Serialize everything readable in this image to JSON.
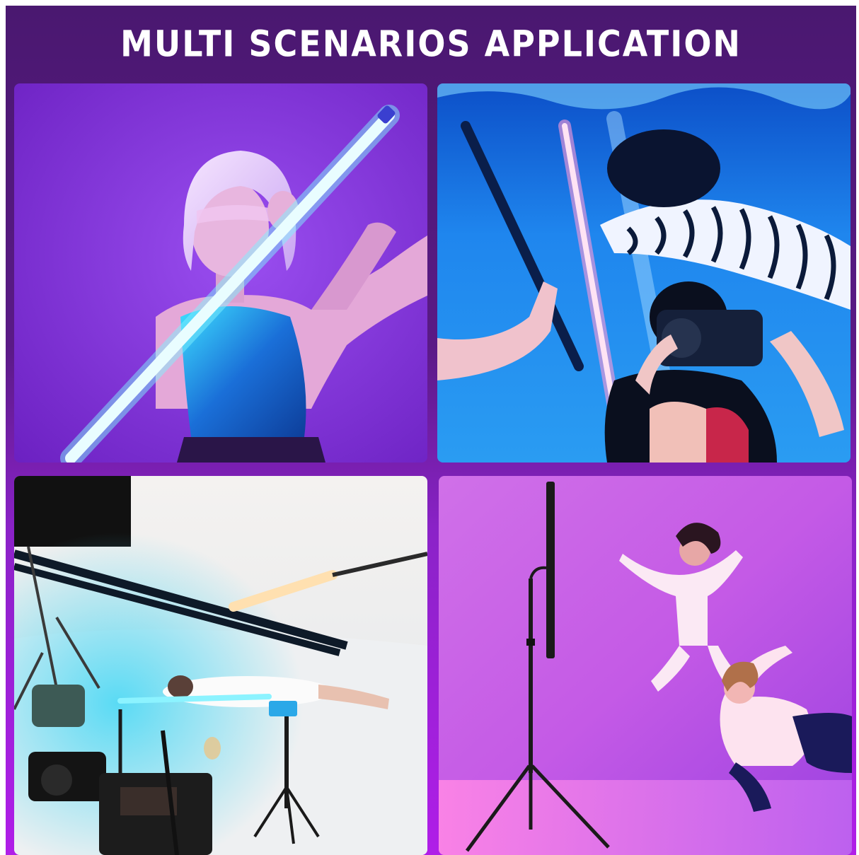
{
  "header": {
    "title": "MULTI SCENARIOS APPLICATION"
  },
  "scenes": [
    {
      "name": "portrait-with-light-tube"
    },
    {
      "name": "underwater-shoot"
    },
    {
      "name": "studio-setup"
    },
    {
      "name": "dancers-with-stand-light"
    }
  ],
  "colors": {
    "banner": "#4a1870",
    "purple_bg": "#8a2ad8",
    "underwater_blue": "#1e8ef0",
    "studio_white": "#eceef0",
    "pink_violet": "#d86ae6",
    "cyan_light": "#6fe8ff"
  }
}
